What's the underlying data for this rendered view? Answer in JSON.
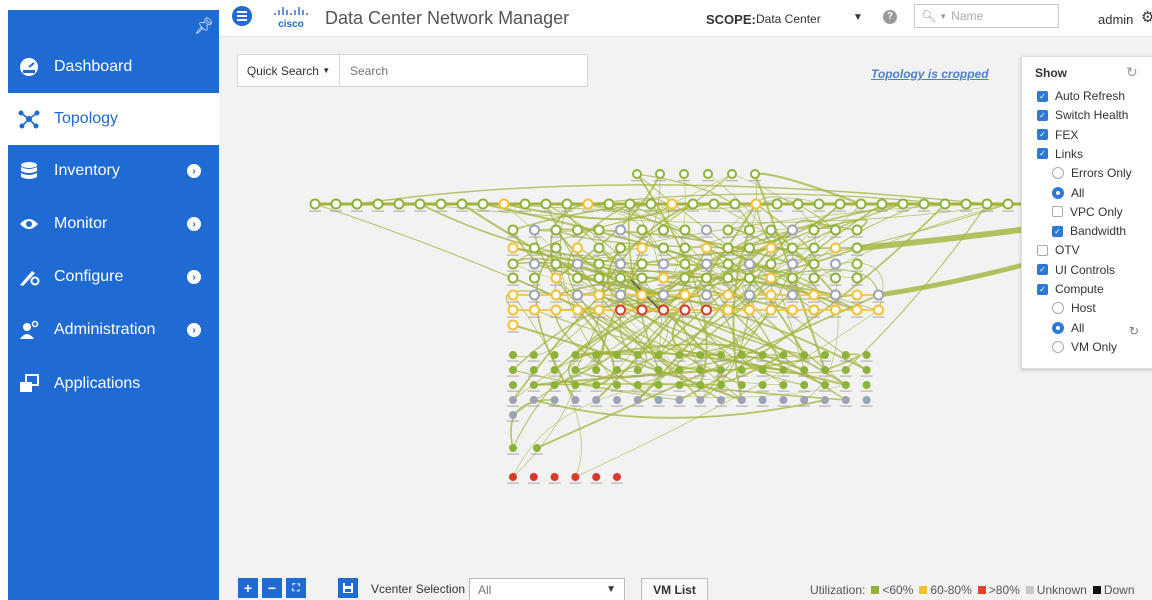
{
  "sidebar": {
    "items": [
      {
        "label": "Dashboard",
        "icon": "dashboard-icon"
      },
      {
        "label": "Topology",
        "icon": "topology-icon",
        "active": true
      },
      {
        "label": "Inventory",
        "icon": "inventory-icon",
        "has_submenu": true
      },
      {
        "label": "Monitor",
        "icon": "monitor-icon",
        "has_submenu": true
      },
      {
        "label": "Configure",
        "icon": "configure-icon",
        "has_submenu": true
      },
      {
        "label": "Administration",
        "icon": "administration-icon",
        "has_submenu": true
      },
      {
        "label": "Applications",
        "icon": "applications-icon"
      }
    ],
    "accent": "#1f6ad3"
  },
  "header": {
    "logo_text": "cisco",
    "title": "Data Center Network Manager",
    "scope_label": "SCOPE:",
    "scope_value": "Data Center",
    "search_placeholder": "Name",
    "user": "admin"
  },
  "canvas": {
    "quick_search_label": "Quick Search",
    "search_placeholder": "Search",
    "cropped_notice": "Topology is cropped"
  },
  "show_panel": {
    "title": "Show",
    "options": [
      {
        "label": "Auto Refresh",
        "type": "checkbox",
        "checked": true,
        "indent": 0
      },
      {
        "label": "Switch Health",
        "type": "checkbox",
        "checked": true,
        "indent": 0
      },
      {
        "label": "FEX",
        "type": "checkbox",
        "checked": true,
        "indent": 0
      },
      {
        "label": "Links",
        "type": "checkbox",
        "checked": true,
        "indent": 0
      },
      {
        "label": "Errors Only",
        "type": "radio",
        "checked": false,
        "indent": 1
      },
      {
        "label": "All",
        "type": "radio",
        "checked": true,
        "indent": 1
      },
      {
        "label": "VPC Only",
        "type": "checkbox",
        "checked": false,
        "indent": 1
      },
      {
        "label": "Bandwidth",
        "type": "checkbox",
        "checked": true,
        "indent": 1
      },
      {
        "label": "OTV",
        "type": "checkbox",
        "checked": false,
        "indent": 0
      },
      {
        "label": "UI Controls",
        "type": "checkbox",
        "checked": true,
        "indent": 0
      },
      {
        "label": "Compute",
        "type": "checkbox",
        "checked": true,
        "indent": 0
      },
      {
        "label": "Host",
        "type": "radio",
        "checked": false,
        "indent": 1
      },
      {
        "label": "All",
        "type": "radio",
        "checked": true,
        "indent": 1
      },
      {
        "label": "VM Only",
        "type": "radio",
        "checked": false,
        "indent": 1
      }
    ]
  },
  "toolbar": {
    "zoom_in": "+",
    "zoom_out": "−",
    "vcenter_label": "Vcenter Selection :",
    "vcenter_value": "All",
    "vm_list_label": "VM List"
  },
  "legend": {
    "title": "Utilization:",
    "items": [
      {
        "label": "<60%",
        "color": "#8db23a"
      },
      {
        "label": "60-80%",
        "color": "#f5c031"
      },
      {
        "label": ">80%",
        "color": "#e0442f"
      },
      {
        "label": "Unknown",
        "color": "#c8c8c8"
      },
      {
        "label": "Down",
        "color": "#111111"
      }
    ]
  },
  "colors": {
    "node_green": "#8db23a",
    "node_yellow": "#f5c031",
    "node_red": "#d8392b",
    "node_gray": "#9aa3b5",
    "link_green": "#a3b33b"
  }
}
